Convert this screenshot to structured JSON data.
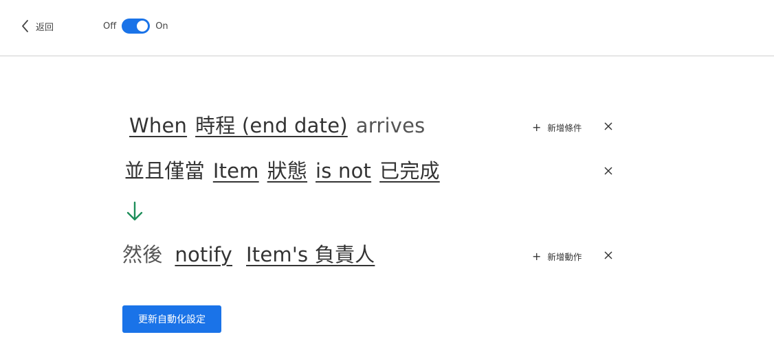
{
  "header": {
    "back_label": "返回",
    "toggle": {
      "off_label": "Off",
      "on_label": "On",
      "state": "on"
    }
  },
  "trigger": {
    "when": "When",
    "field": "時程 (end date)",
    "verb": "arrives",
    "add_condition_label": "新增條件"
  },
  "condition": {
    "prefix": "並且僅當",
    "subject": "Item",
    "field": "狀態",
    "operator": "is not",
    "value": "已完成"
  },
  "action": {
    "prefix": "然後",
    "verb": "notify",
    "target": "Item's 負責人",
    "add_action_label": "新增動作"
  },
  "submit_label": "更新自動化設定",
  "colors": {
    "accent": "#1a73e8",
    "arrow": "#1e8e5a",
    "text": "#333333"
  }
}
